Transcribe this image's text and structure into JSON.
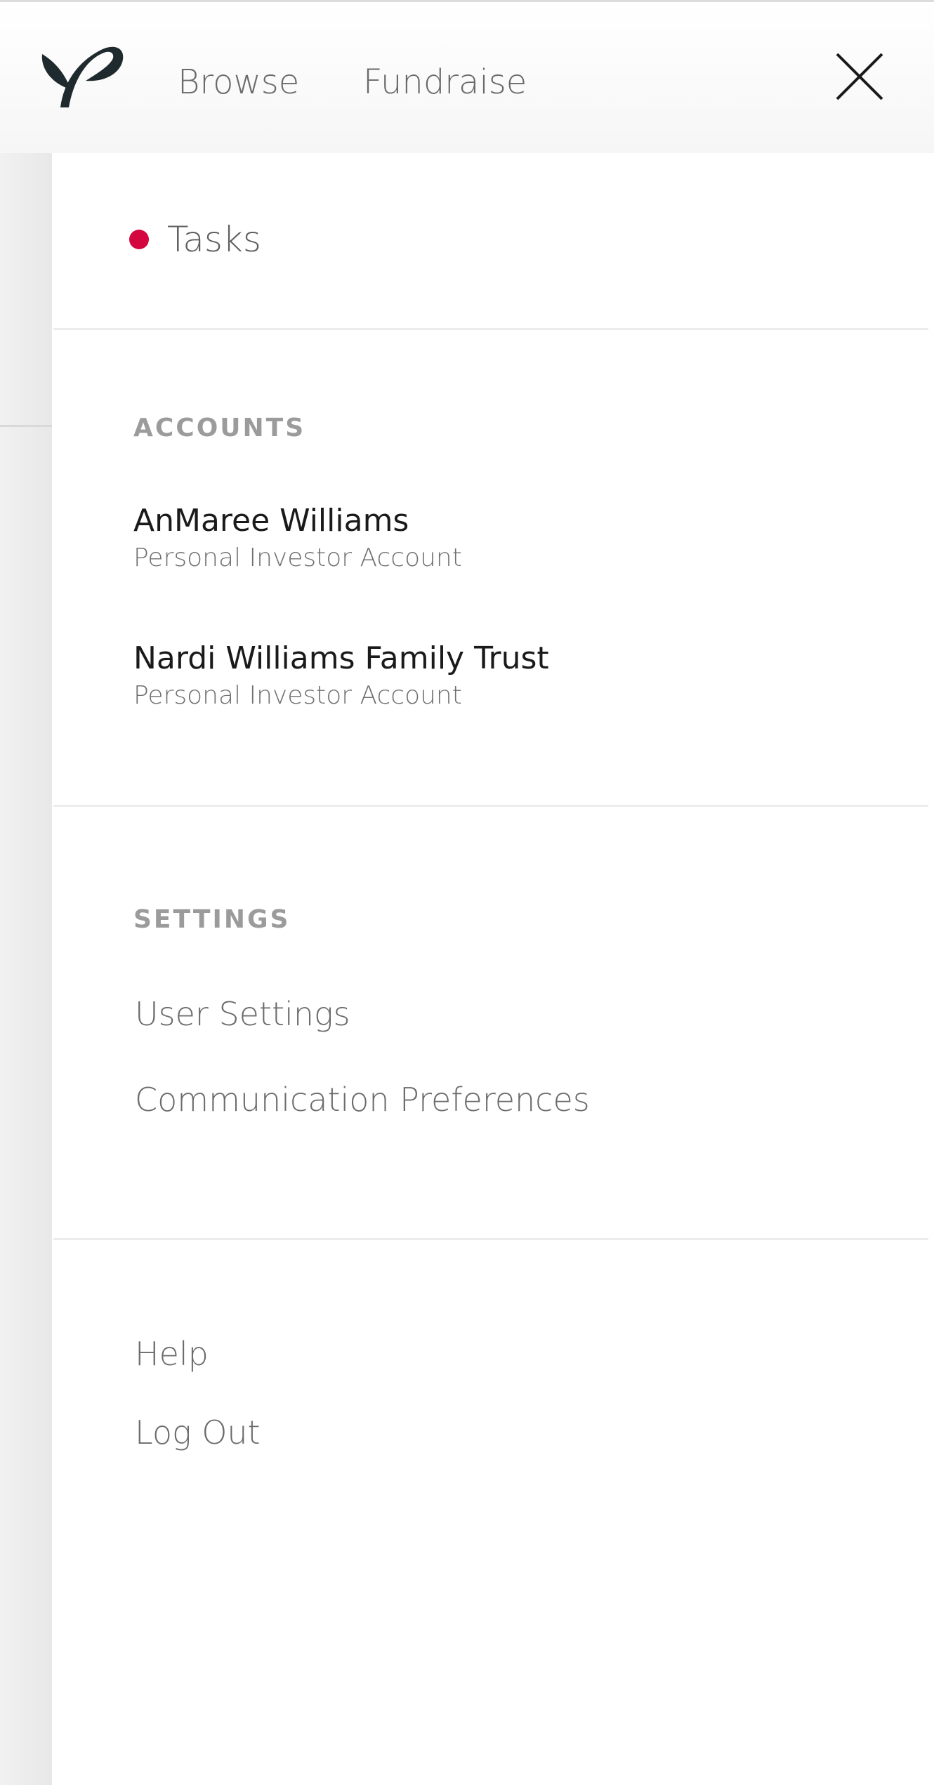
{
  "header": {
    "logo_icon": "sprout-leaf-logo",
    "nav": {
      "browse_label": "Browse",
      "fundraise_label": "Fundraise"
    },
    "close_icon": "close-x-icon"
  },
  "drawer": {
    "tasks": {
      "label": "Tasks",
      "indicator_color": "#d3063f"
    },
    "accounts": {
      "heading": "ACCOUNTS",
      "items": [
        {
          "name": "AnMaree Williams",
          "type": "Personal Investor Account"
        },
        {
          "name": "Nardi Williams Family Trust",
          "type": "Personal Investor Account"
        }
      ]
    },
    "settings": {
      "heading": "SETTINGS",
      "items": [
        {
          "label": "User Settings"
        },
        {
          "label": "Communication Preferences"
        }
      ]
    },
    "misc": {
      "items": [
        {
          "label": "Help"
        },
        {
          "label": "Log Out"
        }
      ]
    }
  },
  "colors": {
    "accent_dot": "#d3063f",
    "heading_gray": "#9b9b9b",
    "link_gray": "#6b6b6b",
    "text_dark": "#1a1a1a"
  }
}
